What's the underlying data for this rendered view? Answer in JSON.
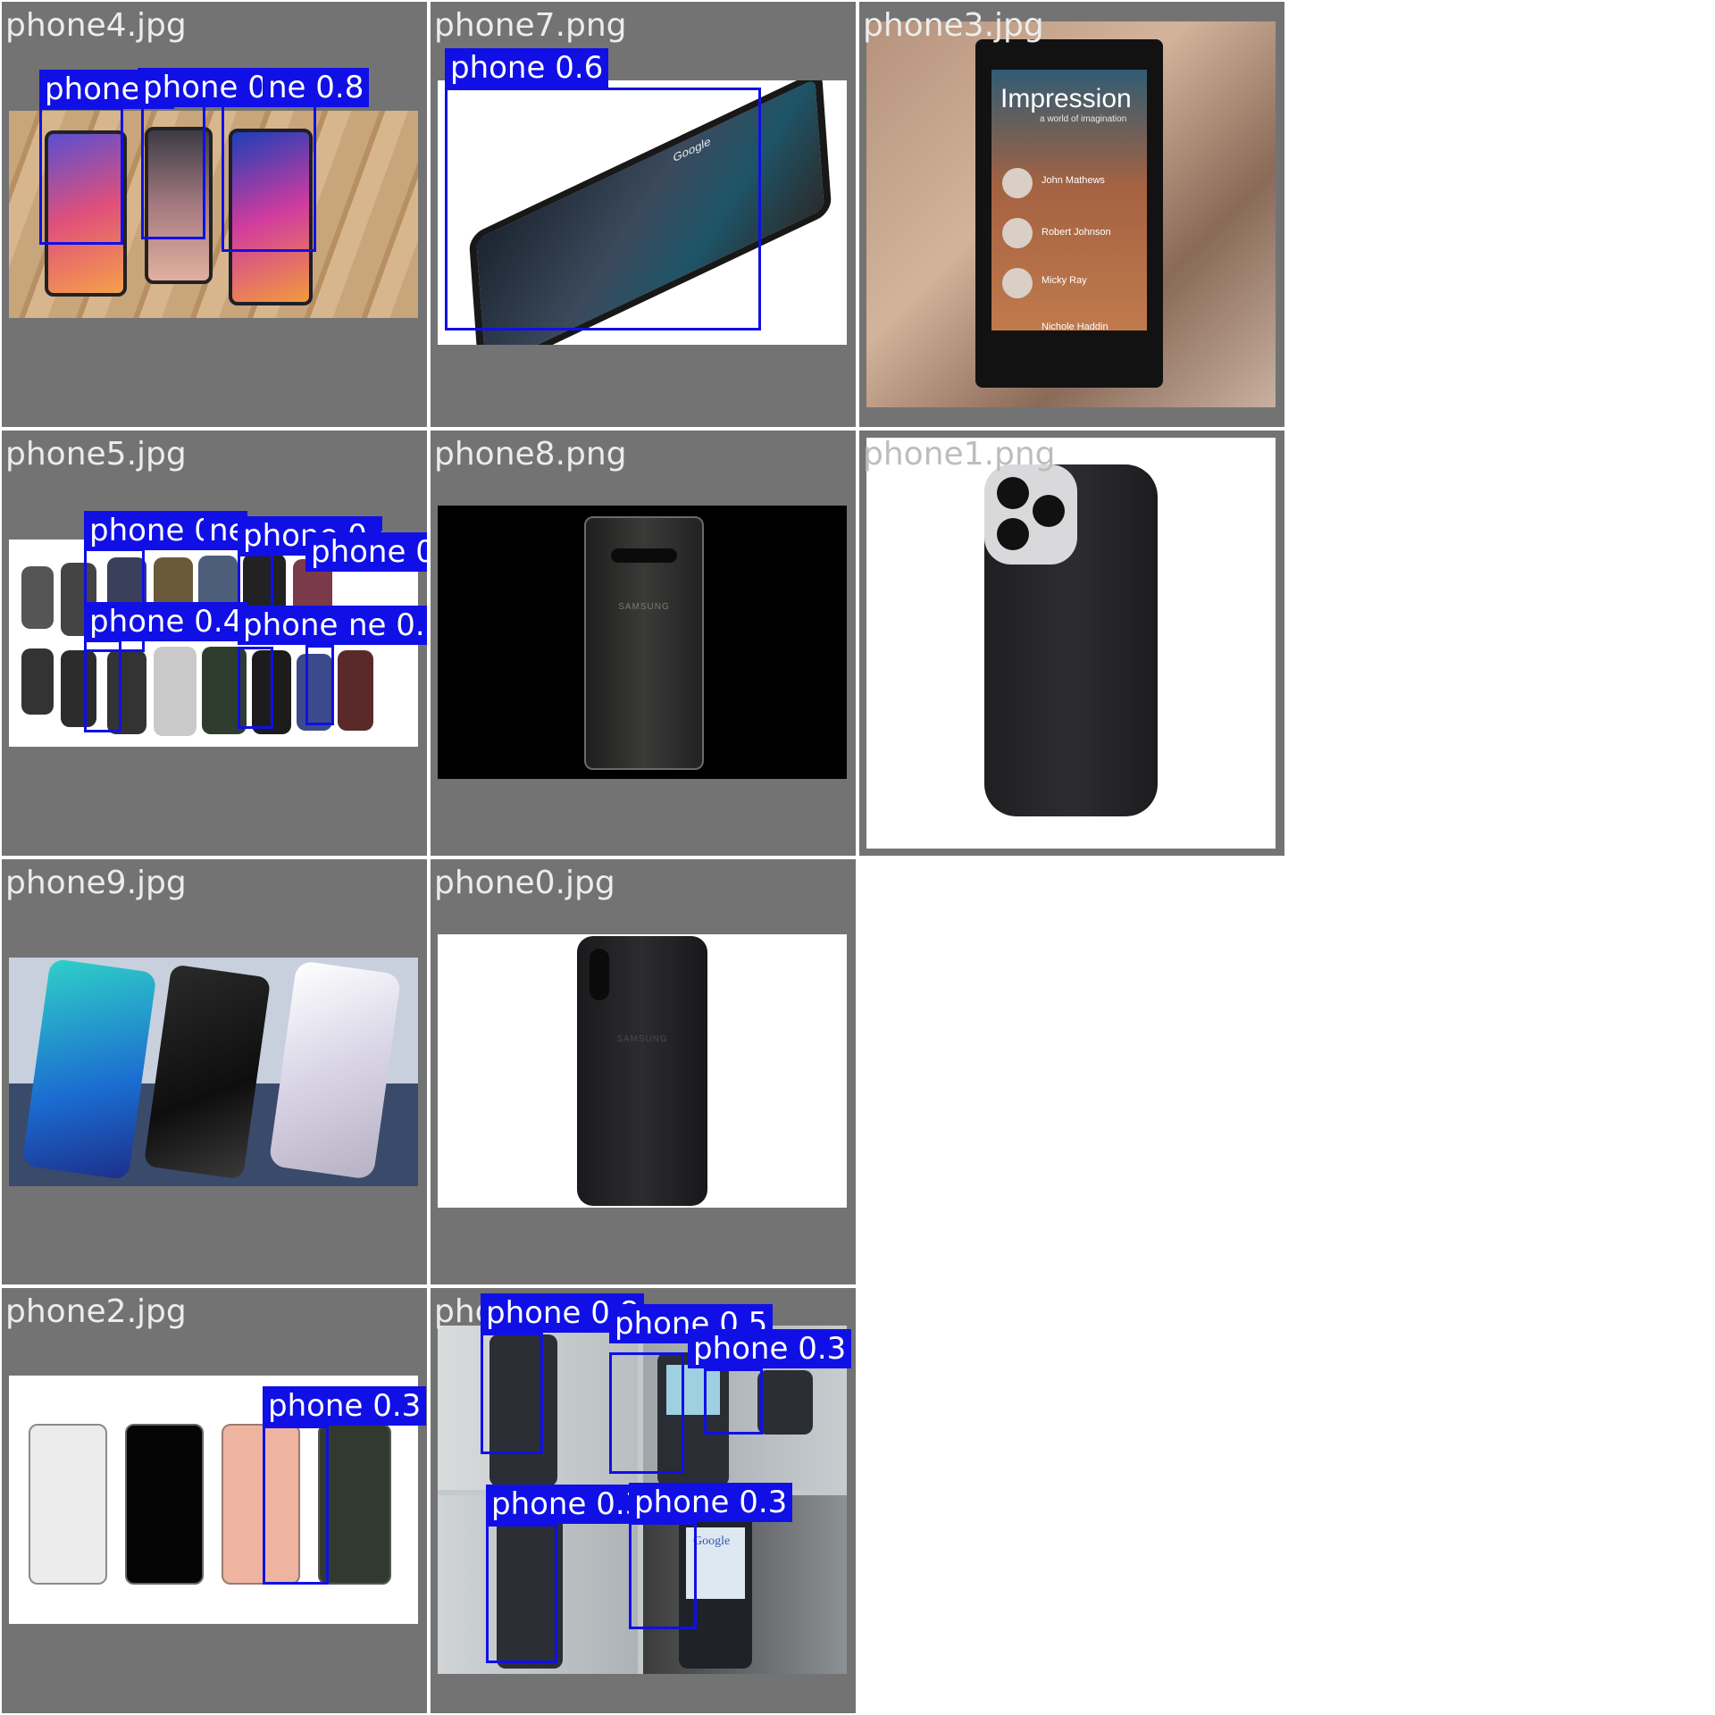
{
  "grid": {
    "tiles": [
      {
        "filename": "phone4.jpg"
      },
      {
        "filename": "phone7.png"
      },
      {
        "filename": "phone3.jpg"
      },
      {
        "filename": "phone5.jpg"
      },
      {
        "filename": "phone8.png"
      },
      {
        "filename": "phone1.png"
      },
      {
        "filename": "phone9.jpg"
      },
      {
        "filename": "phone0.jpg"
      },
      {
        "filename": "phone2.jpg"
      },
      {
        "filename": "phone6.jpg"
      }
    ]
  },
  "detections": {
    "phone4": [
      "phone 0",
      "phone 0.6",
      "ne 0.8"
    ],
    "phone7": [
      "phone 0.6"
    ],
    "phone5": [
      "phone 0.3",
      "ne",
      "phone 0.4",
      "phone 0.3",
      "phone 0.3",
      "ne 0.3"
    ],
    "phone2": [
      "phone 0.3"
    ],
    "phone6": [
      "phone 0.8",
      "phone 0.5",
      "phone 0.3",
      "phone 0.3",
      "phone 0.3"
    ]
  },
  "screen_text": {
    "phone3_title": "Impression",
    "phone3_subtitle": "a world of imagination",
    "phone3_contacts": [
      "John Mathews",
      "Robert Johnson",
      "Micky Ray",
      "Nichole Haddin"
    ],
    "phone7_brand": "Google",
    "phone8_brand": "SAMSUNG",
    "phone0_brand": "SAMSUNG",
    "phone6_brand": "Google"
  },
  "colors": {
    "tile_background": "#737373",
    "box": "#1010e6",
    "label_text": "#ffffff"
  }
}
